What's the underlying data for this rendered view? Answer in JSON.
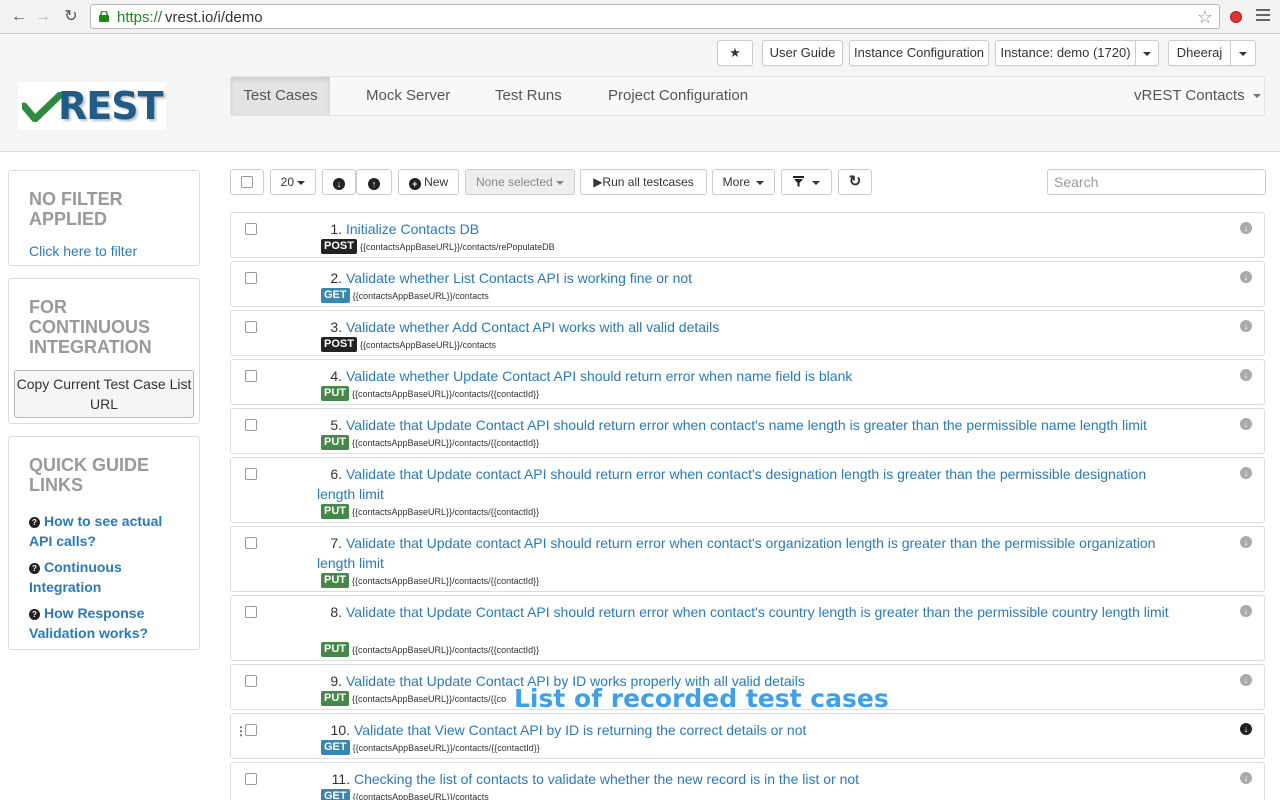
{
  "browser": {
    "url_scheme": "https://",
    "url_rest": "vrest.io/i/demo"
  },
  "header": {
    "top_buttons": {
      "star_icon": "★",
      "user_guide": "User Guide",
      "instance_configuration": "Instance Configuration",
      "instance": "Instance: demo (1720)",
      "user": "Dheeraj"
    },
    "logo_text": "REST",
    "nav": {
      "items": [
        {
          "label": "Test Cases",
          "active": true
        },
        {
          "label": "Mock Server"
        },
        {
          "label": "Test Runs"
        },
        {
          "label": "Project Configuration"
        }
      ],
      "project_selector": "vREST Contacts"
    }
  },
  "sidebar": {
    "filter": {
      "title": "NO FILTER APPLIED",
      "link": "Click here to filter"
    },
    "ci": {
      "title": "FOR CONTINUOUS INTEGRATION",
      "button": "Copy Current Test Case List URL"
    },
    "quick_guide": {
      "title": "QUICK GUIDE LINKS",
      "links": [
        "How to see actual API calls?",
        "Continuous Integration",
        "How Response Validation works?"
      ]
    }
  },
  "toolbar": {
    "page_size": "20",
    "new_label": "New",
    "none_selected": "None selected",
    "run_all": "Run all testcases",
    "more": "More",
    "search_placeholder": "Search"
  },
  "test_cases": [
    {
      "num": "1.",
      "title": "Initialize Contacts DB",
      "method": "POST",
      "url": "{{contactsAppBaseURL}}/contacts/rePopulateDB"
    },
    {
      "num": "2.",
      "title": "Validate whether List Contacts API is working fine or not",
      "method": "GET",
      "url": "{{contactsAppBaseURL}}/contacts"
    },
    {
      "num": "3.",
      "title": "Validate whether Add Contact API works with all valid details",
      "method": "POST",
      "url": "{{contactsAppBaseURL}}/contacts"
    },
    {
      "num": "4.",
      "title": "Validate whether Update Contact API should return error when name field is blank",
      "method": "PUT",
      "url": "{{contactsAppBaseURL}}/contacts/{{contactId}}"
    },
    {
      "num": "5.",
      "title": "Validate that Update Contact API should return error when contact's name length is greater than the permissible name length limit",
      "method": "PUT",
      "url": "{{contactsAppBaseURL}}/contacts/{{contactId}}"
    },
    {
      "num": "6.",
      "title": "Validate that Update contact API should return error when contact's designation length is greater than the permissible designation length limit",
      "method": "PUT",
      "url": "{{contactsAppBaseURL}}/contacts/{{contactId}}"
    },
    {
      "num": "7.",
      "title": "Validate that Update contact API should return error when contact's organization length is greater than the permissible organization length limit",
      "method": "PUT",
      "url": "{{contactsAppBaseURL}}/contacts/{{contactId}}"
    },
    {
      "num": "8.",
      "title": "Validate that Update Contact API should return error when contact's country length is greater than the permissible country length limit",
      "method": "PUT",
      "url": "{{contactsAppBaseURL}}/contacts/{{contactId}}"
    },
    {
      "num": "9.",
      "title": "Validate that Update Contact API by ID works properly with all valid details",
      "method": "PUT",
      "url": "{{contactsAppBaseURL}}/contacts/{{co"
    },
    {
      "num": "10.",
      "title": "Validate that View Contact API by ID is returning the correct details or not",
      "method": "GET",
      "url": "{{contactsAppBaseURL}}/contacts/{{contactId}}"
    },
    {
      "num": "11.",
      "title": "Checking the list of contacts to validate whether the new record is in the list or not",
      "method": "GET",
      "url": "{{contactsAppBaseURL}}/contacts"
    }
  ],
  "overlay_caption": "List of recorded test cases"
}
